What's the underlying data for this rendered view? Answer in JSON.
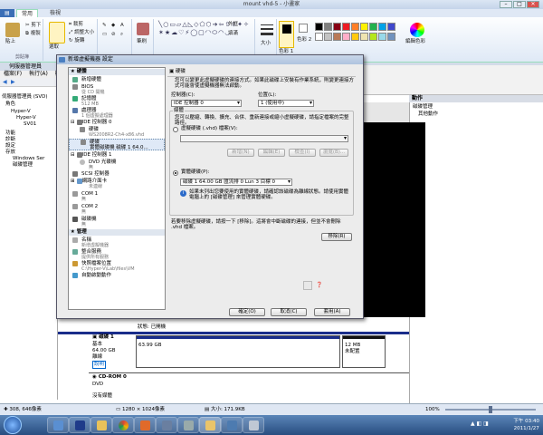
{
  "paint": {
    "title": "mount vhd-5 - 小畫家",
    "tabs": [
      "常用",
      "檢視"
    ],
    "groups": {
      "clipboard": {
        "label": "剪貼簿",
        "paste": "貼上",
        "cut": "剪下",
        "copy": "複製"
      },
      "image": {
        "select": "選取",
        "crop": "裁剪",
        "resize": "調整大小",
        "rotate": "旋轉"
      },
      "tools": {
        "brush": "筆刷"
      },
      "shapes": {
        "outline": "外框",
        "fill": "填滿"
      },
      "size": "大小",
      "color1": "色彩 1",
      "color2": "色彩 2",
      "edit_colors": "編輯色彩"
    },
    "colors": {
      "accent": "#ffc93c",
      "swatch_palette": [
        "#000000",
        "#7f7f7f",
        "#880015",
        "#ed1c24",
        "#ff7f27",
        "#fff200",
        "#22b14c",
        "#00a2e8",
        "#3f48cc",
        "#a349a4",
        "#ffffff",
        "#c3c3c3",
        "#b97a57",
        "#ffaec9",
        "#ffc90e",
        "#efe4b0",
        "#b5e61d",
        "#99d9ea",
        "#7092be",
        "#c8bfe7"
      ]
    }
  },
  "server_manager": {
    "title": "伺服器管理員",
    "menu": [
      "檔案(F)",
      "執行(A)",
      "檢視"
    ],
    "tree": [
      "伺服器管理員 (SVD)",
      "角色",
      "Hyper-V",
      "Hyper-V",
      "SV01",
      "功能",
      "診斷",
      "設定",
      "存放",
      "Windows Ser",
      "磁碟管理"
    ],
    "actions_header": "動作",
    "actions": [
      "磁碟管理",
      "其他動作"
    ],
    "disks": {
      "status_label": "狀態: 已開機",
      "disk1_name": "磁碟 1",
      "disk1_type": "基本",
      "disk1_size": "64.00 GB",
      "disk1_state": "離線",
      "disk1_help": "說明",
      "disk1_vol": "63.99 GB",
      "disk1_unalloc_size": "12 MB",
      "disk1_unalloc": "未配置",
      "cdrom": "CD-ROM 0",
      "cdrom_label": "DVD",
      "cdrom_nomedia": "沒有媒體"
    }
  },
  "dialog": {
    "title": "新增虛擬機器 設定",
    "left": {
      "sec_hardware": "硬體",
      "add_hw": "新增硬體",
      "bios": "BIOS",
      "bios_sub": "從 CD 開機",
      "memory": "記憶體",
      "memory_sub": "512 MB",
      "cpu": "處理器",
      "cpu_sub": "1 個虛擬處理器",
      "ide0": "IDE 控制器 0",
      "hdd": "硬碟",
      "hdd_sub": "WS2008R2-Ch4-x86.vhd",
      "hdd2": "硬碟",
      "hdd2_sub": "實體磁碟機 磁碟 1 64.0...",
      "ide1": "IDE 控制器 1",
      "dvd": "DVD 光碟機",
      "dvd_sub": "無",
      "scsi": "SCSI 控制器",
      "nic": "網路介面卡",
      "nic_sub": "未連線",
      "com1": "COM 1",
      "com1_sub": "無",
      "com2": "COM 2",
      "com2_sub": "無",
      "floppy": "磁碟機",
      "floppy_sub": "無",
      "sec_mgmt": "管理",
      "name": "名稱",
      "name_sub": "新增虛擬機器",
      "integration": "整合服務",
      "integration_sub": "提供所有服務",
      "snapshot": "快照檔案位置",
      "snapshot_sub": "C:\\Hyper-V\\Lab\\files\\VM",
      "autostart": "自動啟動動作"
    },
    "right": {
      "section": "硬碟",
      "desc": "您可以變更此虛擬硬碟的連接方式。如果此磁碟上安裝有作業系統，則變更連接方式可能會使虛擬機器無法啟動。",
      "controller_label": "控制器(C):",
      "controller_value": "IDE 控制器 0",
      "location_label": "位置(L):",
      "location_value": "1 (使用中)",
      "media_label": "媒體",
      "media_desc": "您可以壓縮、轉換、擴充、合併、重新連接或縮小虛擬硬碟，請指定檔案的完整路徑。",
      "vhd_radio": "虛擬硬碟 (.vhd) 檔案(V):",
      "btn_new": "新增(N)",
      "btn_edit": "編輯(E)",
      "btn_inspect": "檢查(I)",
      "btn_browse": "瀏覽(B)...",
      "phys_radio": "實體硬碟(P):",
      "phys_value": "磁碟 1 64.00 GB 匯流排 0 Lun 3 目標 0",
      "info_text": "如果未列出您要使用的實體硬碟，請確認該磁碟為離線狀態。請使用實體電腦上的 [磁碟管理] 來管理實體硬碟。",
      "remove_desc": "若要移除虛擬硬碟，請按一下 [移除]。這將會中斷磁碟的連接，但並不會刪除 .vhd 檔案。",
      "btn_remove": "移除(R)"
    },
    "buttons": {
      "ok": "確定(O)",
      "cancel": "取消(C)",
      "apply": "套用(A)"
    }
  },
  "statusbar": {
    "coords": "308, 646像素",
    "dimensions": "1280 × 1024像素",
    "filesize": "大小: 171.9KB",
    "zoom": "100%"
  },
  "taskbar": {
    "time": "下午 03:40",
    "date": "2011/1/27"
  }
}
